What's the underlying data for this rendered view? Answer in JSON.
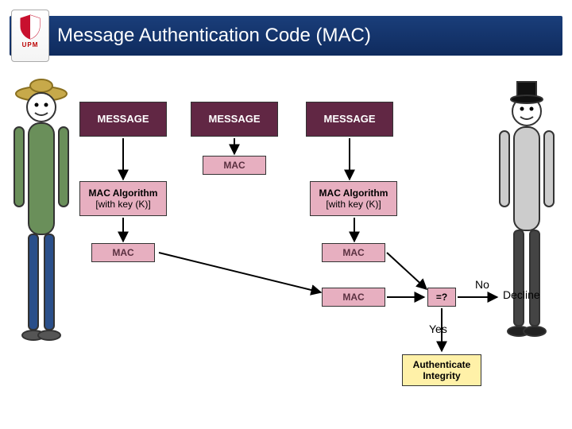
{
  "title": "Message Authentication Code (MAC)",
  "logo_letters": "UPM",
  "sender": {
    "message": "MESSAGE",
    "alg_line1": "MAC Algorithm",
    "alg_line2": "[with key (K)]",
    "mac_out": "MAC"
  },
  "channel": {
    "message": "MESSAGE",
    "mac": "MAC"
  },
  "receiver": {
    "message": "MESSAGE",
    "alg_line1": "MAC Algorithm",
    "alg_line2": "[with key (K)]",
    "mac_out": "MAC",
    "mac_in": "MAC"
  },
  "compare": "=?",
  "yes_label": "Yes",
  "no_label": "No",
  "decline": "Decline",
  "authenticate": "Authenticate Integrity"
}
